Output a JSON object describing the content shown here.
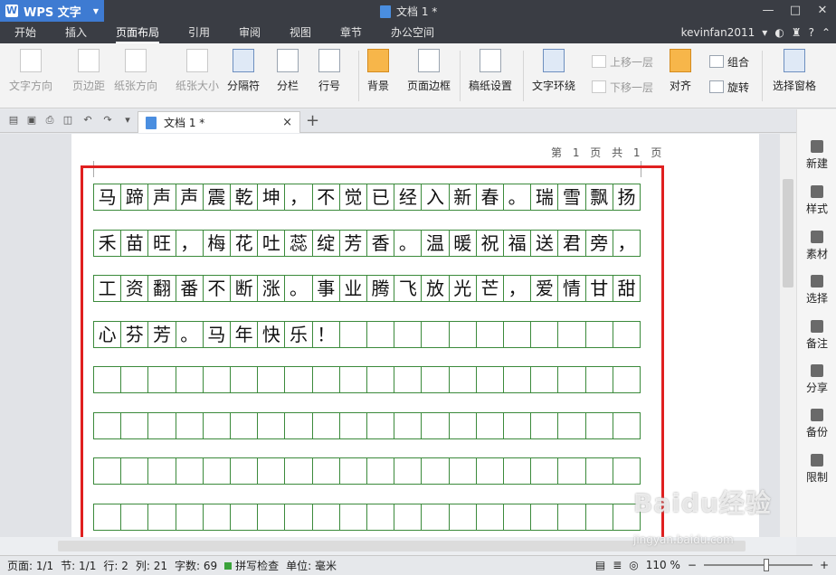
{
  "app": {
    "name": "WPS 文字",
    "doc_title": "文档 1 *"
  },
  "window": {
    "minimize": "—",
    "maximize": "□",
    "close": "✕"
  },
  "menu": {
    "tabs": [
      "开始",
      "插入",
      "页面布局",
      "引用",
      "审阅",
      "视图",
      "章节",
      "办公空间"
    ],
    "active": "页面布局",
    "user": "kevinfan2011"
  },
  "ribbon": {
    "text_direction": "文字方向",
    "margins": "页边距",
    "orientation": "纸张方向",
    "paper_size": "纸张大小",
    "separator": "分隔符",
    "columns": "分栏",
    "line_number": "行号",
    "background": "背景",
    "page_border": "页面边框",
    "manuscript": "稿纸设置",
    "text_wrap": "文字环绕",
    "bring_forward": "上移一层",
    "send_backward": "下移一层",
    "align": "对齐",
    "group": "组合",
    "rotate": "旋转",
    "selection_pane": "选择窗格"
  },
  "doc_tab": {
    "title": "文档 1 *",
    "close": "×",
    "add": "+"
  },
  "page": {
    "info": "第 1 页 共 1 页",
    "lines": [
      "马蹄声声震乾坤，不觉已经入新春。瑞雪飘扬",
      "禾苗旺，梅花吐蕊绽芳香。温暖祝福送君旁，",
      "工资翻番不断涨。事业腾飞放光芒，爱情甘甜",
      "心芬芳。马年快乐！",
      "",
      "",
      "",
      ""
    ]
  },
  "task_pane": [
    "新建",
    "样式",
    "素材",
    "选择",
    "备注",
    "分享",
    "备份",
    "限制"
  ],
  "status": {
    "page": "页面: 1/1",
    "section": "节: 1/1",
    "line": "行: 2",
    "column": "列: 21",
    "word_count": "字数: 69",
    "spell_check": "拼写检查",
    "unit": "单位: 毫米",
    "zoom": "110 %"
  },
  "colors": {
    "accent": "#3e7bd2",
    "grid": "#3b8a3b",
    "highlight": "#e02020"
  },
  "watermark": {
    "brand": "Baidu经验",
    "url": "jingyan.baidu.com"
  }
}
